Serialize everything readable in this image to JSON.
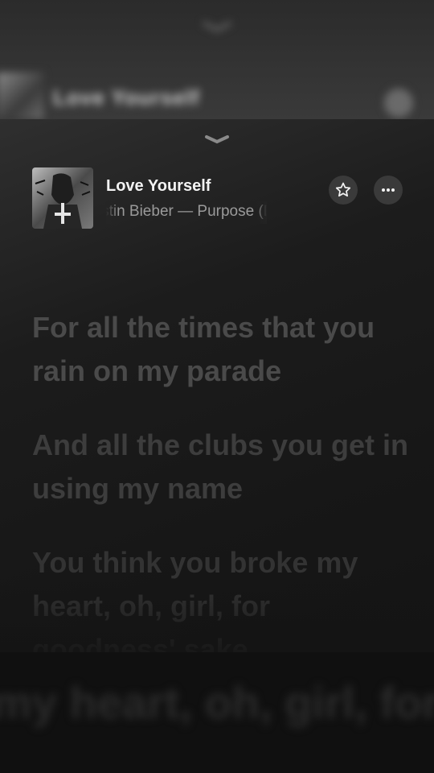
{
  "background_player": {
    "title": "Love Yourself"
  },
  "now_playing": {
    "title": "Love Yourself",
    "subtitle": "Justin Bieber — Purpose (Deluxe)",
    "artwork_icon": "album-artwork",
    "favorite_icon": "star-icon",
    "more_icon": "ellipsis-icon",
    "collapse_icon": "chevron-down-icon"
  },
  "lyrics": [
    "For all the times that you rain on my parade",
    "And all the clubs you get in using my name",
    "You think you broke my heart, oh, girl, for goodness' sake"
  ],
  "overflow_lyric": "my heart, oh, girl, for"
}
